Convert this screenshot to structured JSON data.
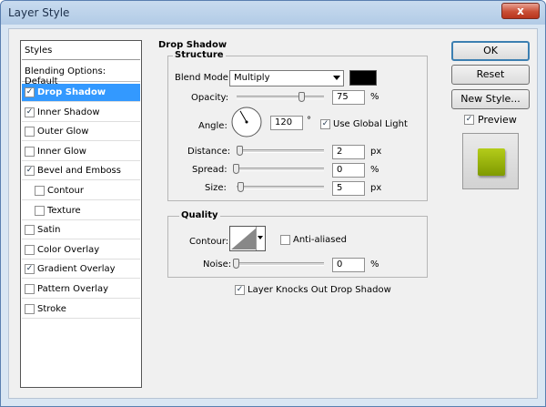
{
  "window": {
    "title": "Layer Style",
    "close_glyph": "x"
  },
  "styles_panel": {
    "header": "Styles",
    "blending_options": "Blending Options: Default",
    "items": [
      {
        "label": "Drop Shadow",
        "checked": true,
        "selected": true,
        "indent": false
      },
      {
        "label": "Inner Shadow",
        "checked": true,
        "selected": false,
        "indent": false
      },
      {
        "label": "Outer Glow",
        "checked": false,
        "selected": false,
        "indent": false
      },
      {
        "label": "Inner Glow",
        "checked": false,
        "selected": false,
        "indent": false
      },
      {
        "label": "Bevel and Emboss",
        "checked": true,
        "selected": false,
        "indent": false
      },
      {
        "label": "Contour",
        "checked": false,
        "selected": false,
        "indent": true
      },
      {
        "label": "Texture",
        "checked": false,
        "selected": false,
        "indent": true
      },
      {
        "label": "Satin",
        "checked": false,
        "selected": false,
        "indent": false
      },
      {
        "label": "Color Overlay",
        "checked": false,
        "selected": false,
        "indent": false
      },
      {
        "label": "Gradient Overlay",
        "checked": true,
        "selected": false,
        "indent": false
      },
      {
        "label": "Pattern Overlay",
        "checked": false,
        "selected": false,
        "indent": false
      },
      {
        "label": "Stroke",
        "checked": false,
        "selected": false,
        "indent": false
      }
    ]
  },
  "drop_shadow": {
    "title": "Drop Shadow",
    "structure": {
      "title": "Structure",
      "blend_mode_label": "Blend Mode:",
      "blend_mode_value": "Multiply",
      "shadow_color": "#000000",
      "opacity_label": "Opacity:",
      "opacity_value": "75",
      "opacity_fraction": 0.75,
      "opacity_unit": "%",
      "angle_label": "Angle:",
      "angle_value": "120",
      "angle_unit": "°",
      "use_global_light_label": "Use Global Light",
      "use_global_light_checked": true,
      "distance_label": "Distance:",
      "distance_value": "2",
      "distance_unit": "px",
      "spread_label": "Spread:",
      "spread_value": "0",
      "spread_unit": "%",
      "size_label": "Size:",
      "size_value": "5",
      "size_unit": "px"
    },
    "quality": {
      "title": "Quality",
      "contour_label": "Contour:",
      "anti_aliased_label": "Anti-aliased",
      "anti_aliased_checked": false,
      "noise_label": "Noise:",
      "noise_value": "0",
      "noise_unit": "%"
    },
    "knockout_label": "Layer Knocks Out Drop Shadow",
    "knockout_checked": true
  },
  "buttons": {
    "ok": "OK",
    "reset": "Reset",
    "new_style": "New Style..."
  },
  "preview": {
    "label": "Preview",
    "checked": true,
    "swatch_color": "#9cb80c"
  },
  "colors": {
    "selection": "#3399ff",
    "close_button": "#c94e35",
    "title_bar": "#c8dbef"
  }
}
